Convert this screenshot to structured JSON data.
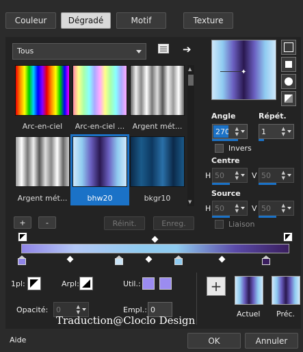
{
  "tabs": [
    {
      "label": "Couleur"
    },
    {
      "label": "Dégradé"
    },
    {
      "label": "Motif"
    },
    {
      "label": "Texture"
    }
  ],
  "category": {
    "value": "Tous"
  },
  "gradients": [
    {
      "label": "Arc-en-ciel"
    },
    {
      "label": "Arc-en-ciel ..."
    },
    {
      "label": "Argent mét..."
    },
    {
      "label": "Argent mét..."
    },
    {
      "label": "bhw20"
    },
    {
      "label": "bkgr10"
    }
  ],
  "buttons": {
    "add": "+",
    "remove": "-",
    "reset": "Réinit.",
    "save": "Enreg.",
    "ok": "OK",
    "cancel": "Annuler",
    "help": "Aide"
  },
  "angle": {
    "label": "Angle",
    "value": "270"
  },
  "repeat": {
    "label": "Répét.",
    "value": "1"
  },
  "invert": {
    "label": "Invers"
  },
  "center": {
    "label": "Centre",
    "h_label": "H",
    "h": "50",
    "v_label": "V",
    "v": "50"
  },
  "source": {
    "label": "Source",
    "h_label": "H",
    "h": "50",
    "v_label": "V",
    "v": "50"
  },
  "link": {
    "label": "Liaison"
  },
  "bottom": {
    "first_label": "1pl:",
    "arpl_label": "Arpl:",
    "util_label": "Util.:",
    "opacity_label": "Opacité:",
    "opacity_value": "0",
    "empl_label": "Empl.:",
    "empl_value": "0",
    "current_label": "Actuel",
    "prev_label": "Préc."
  },
  "watermark": "Traduction@Cloclo Design",
  "colors": {
    "stop_purple": "#8f84e6",
    "stop_blue": "#8fcbf0",
    "util_color": "#9b8cf0"
  }
}
